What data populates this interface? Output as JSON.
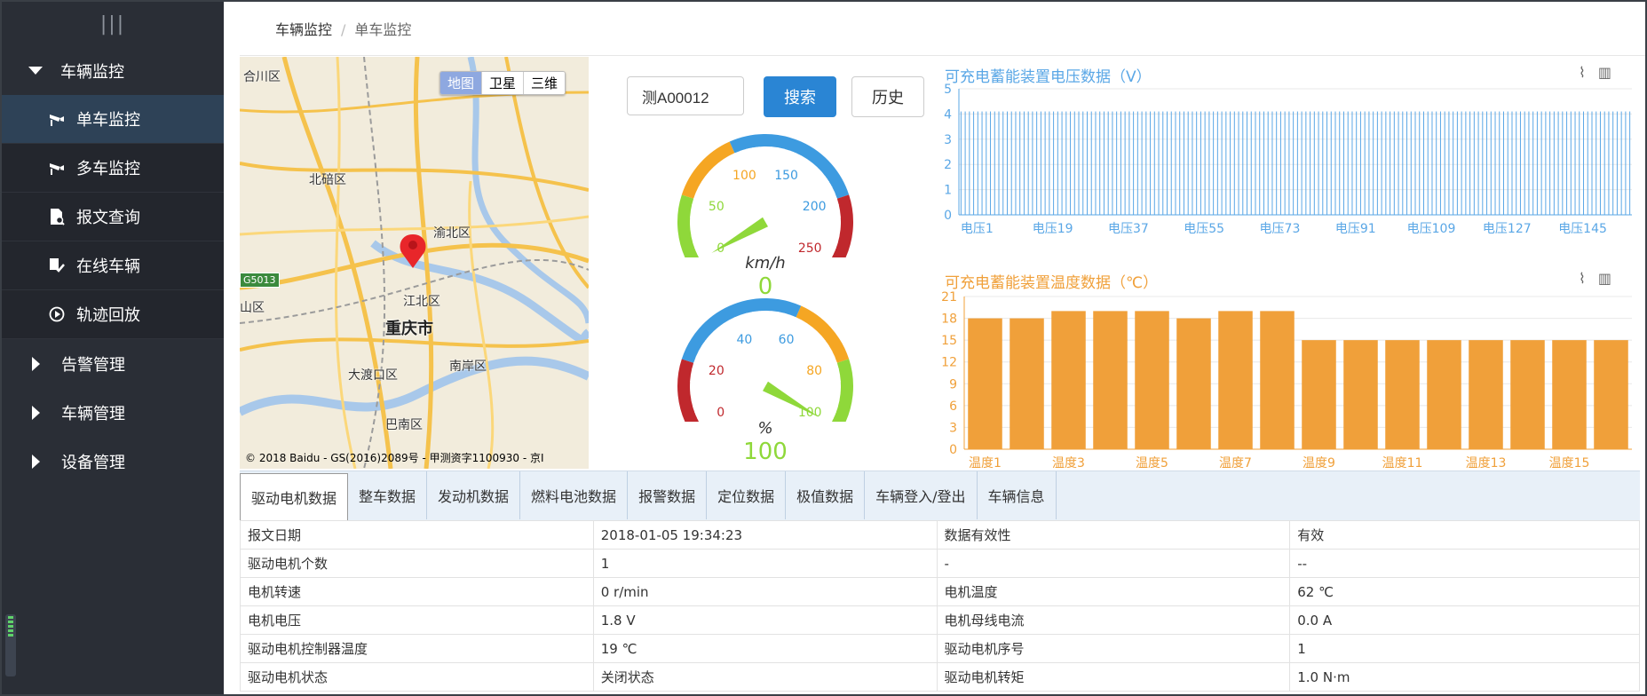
{
  "sidebar": {
    "toggle_glyph": "|||",
    "groups": [
      {
        "label": "车辆监控",
        "expanded": true
      },
      {
        "label": "告警管理",
        "expanded": false
      },
      {
        "label": "车辆管理",
        "expanded": false
      },
      {
        "label": "设备管理",
        "expanded": false
      }
    ],
    "sub_items": [
      {
        "label": "单车监控",
        "icon": "camera-icon",
        "active": true
      },
      {
        "label": "多车监控",
        "icon": "camera-icon",
        "active": false
      },
      {
        "label": "报文查询",
        "icon": "document-search-icon",
        "active": false
      },
      {
        "label": "在线车辆",
        "icon": "car-check-icon",
        "active": false
      },
      {
        "label": "轨迹回放",
        "icon": "replay-icon",
        "active": false
      }
    ]
  },
  "breadcrumb": {
    "parent": "车辆监控",
    "separator": "/",
    "current": "单车监控"
  },
  "map": {
    "types": [
      "地图",
      "卫星",
      "三维"
    ],
    "active_type": "地图",
    "labels": [
      "合川区",
      "北碚区",
      "渝北区",
      "江北区",
      "重庆市",
      "南岸区",
      "大渡口区",
      "巴南区",
      "山区"
    ],
    "road_badge": "G5013",
    "copyright": "© 2018 Baidu - GS(2016)2089号 - 甲测资字1100930 - 京I"
  },
  "search": {
    "value": "测A00012",
    "search_label": "搜索",
    "history_label": "历史"
  },
  "speed_gauge": {
    "min": 0,
    "max": 250,
    "ticks": [
      "0",
      "50",
      "100",
      "150",
      "200",
      "250"
    ],
    "unit": "km/h",
    "value": 0,
    "display": "0"
  },
  "soc_gauge": {
    "min": 0,
    "max": 100,
    "ticks": [
      "0",
      "20",
      "40",
      "60",
      "80",
      "100"
    ],
    "unit": "%",
    "value": 100,
    "display": "100"
  },
  "voltage_chart": {
    "title": "可充电蓄能装置电压数据（V）",
    "color": "#5aa7e6",
    "ylim": [
      0,
      5
    ],
    "yticks": [
      "0",
      "1",
      "2",
      "3",
      "4",
      "5"
    ],
    "xlabels": [
      "电压1",
      "电压19",
      "电压37",
      "电压55",
      "电压73",
      "电压91",
      "电压109",
      "电压127",
      "电压145"
    ]
  },
  "temp_chart": {
    "title": "可充电蓄能装置温度数据（℃）",
    "color": "#f0a03a",
    "ylim": [
      0,
      21
    ],
    "yticks": [
      "0",
      "3",
      "6",
      "9",
      "12",
      "15",
      "18",
      "21"
    ],
    "xlabels": [
      "温度1",
      "温度3",
      "温度5",
      "温度7",
      "温度9",
      "温度11",
      "温度13",
      "温度15"
    ]
  },
  "chart_data": [
    {
      "type": "bar",
      "title": "可充电蓄能装置电压数据（V）",
      "categories_count": 160,
      "category_prefix": "电压",
      "value_all": 4.1,
      "ylim": [
        0,
        5
      ]
    },
    {
      "type": "bar",
      "title": "可充电蓄能装置温度数据（℃）",
      "categories": [
        "温度1",
        "温度2",
        "温度3",
        "温度4",
        "温度5",
        "温度6",
        "温度7",
        "温度8",
        "温度9",
        "温度10",
        "温度11",
        "温度12",
        "温度13",
        "温度14",
        "温度15",
        "温度16"
      ],
      "values": [
        18,
        18,
        19,
        19,
        19,
        18,
        19,
        19,
        15,
        15,
        15,
        15,
        15,
        15,
        15,
        15
      ],
      "ylim": [
        0,
        21
      ]
    }
  ],
  "tabs": [
    "驱动电机数据",
    "整车数据",
    "发动机数据",
    "燃料电池数据",
    "报警数据",
    "定位数据",
    "极值数据",
    "车辆登入/登出",
    "车辆信息"
  ],
  "active_tab": 0,
  "table": [
    [
      "报文日期",
      "2018-01-05 19:34:23",
      "数据有效性",
      "有效"
    ],
    [
      "驱动电机个数",
      "1",
      "-",
      "--"
    ],
    [
      "电机转速",
      "0 r/min",
      "电机温度",
      "62 ℃"
    ],
    [
      "电机电压",
      "1.8 V",
      "电机母线电流",
      "0.0 A"
    ],
    [
      "驱动电机控制器温度",
      "19 ℃",
      "驱动电机序号",
      "1"
    ],
    [
      "驱动电机状态",
      "关闭状态",
      "驱动电机转矩",
      "1.0 N·m"
    ]
  ]
}
